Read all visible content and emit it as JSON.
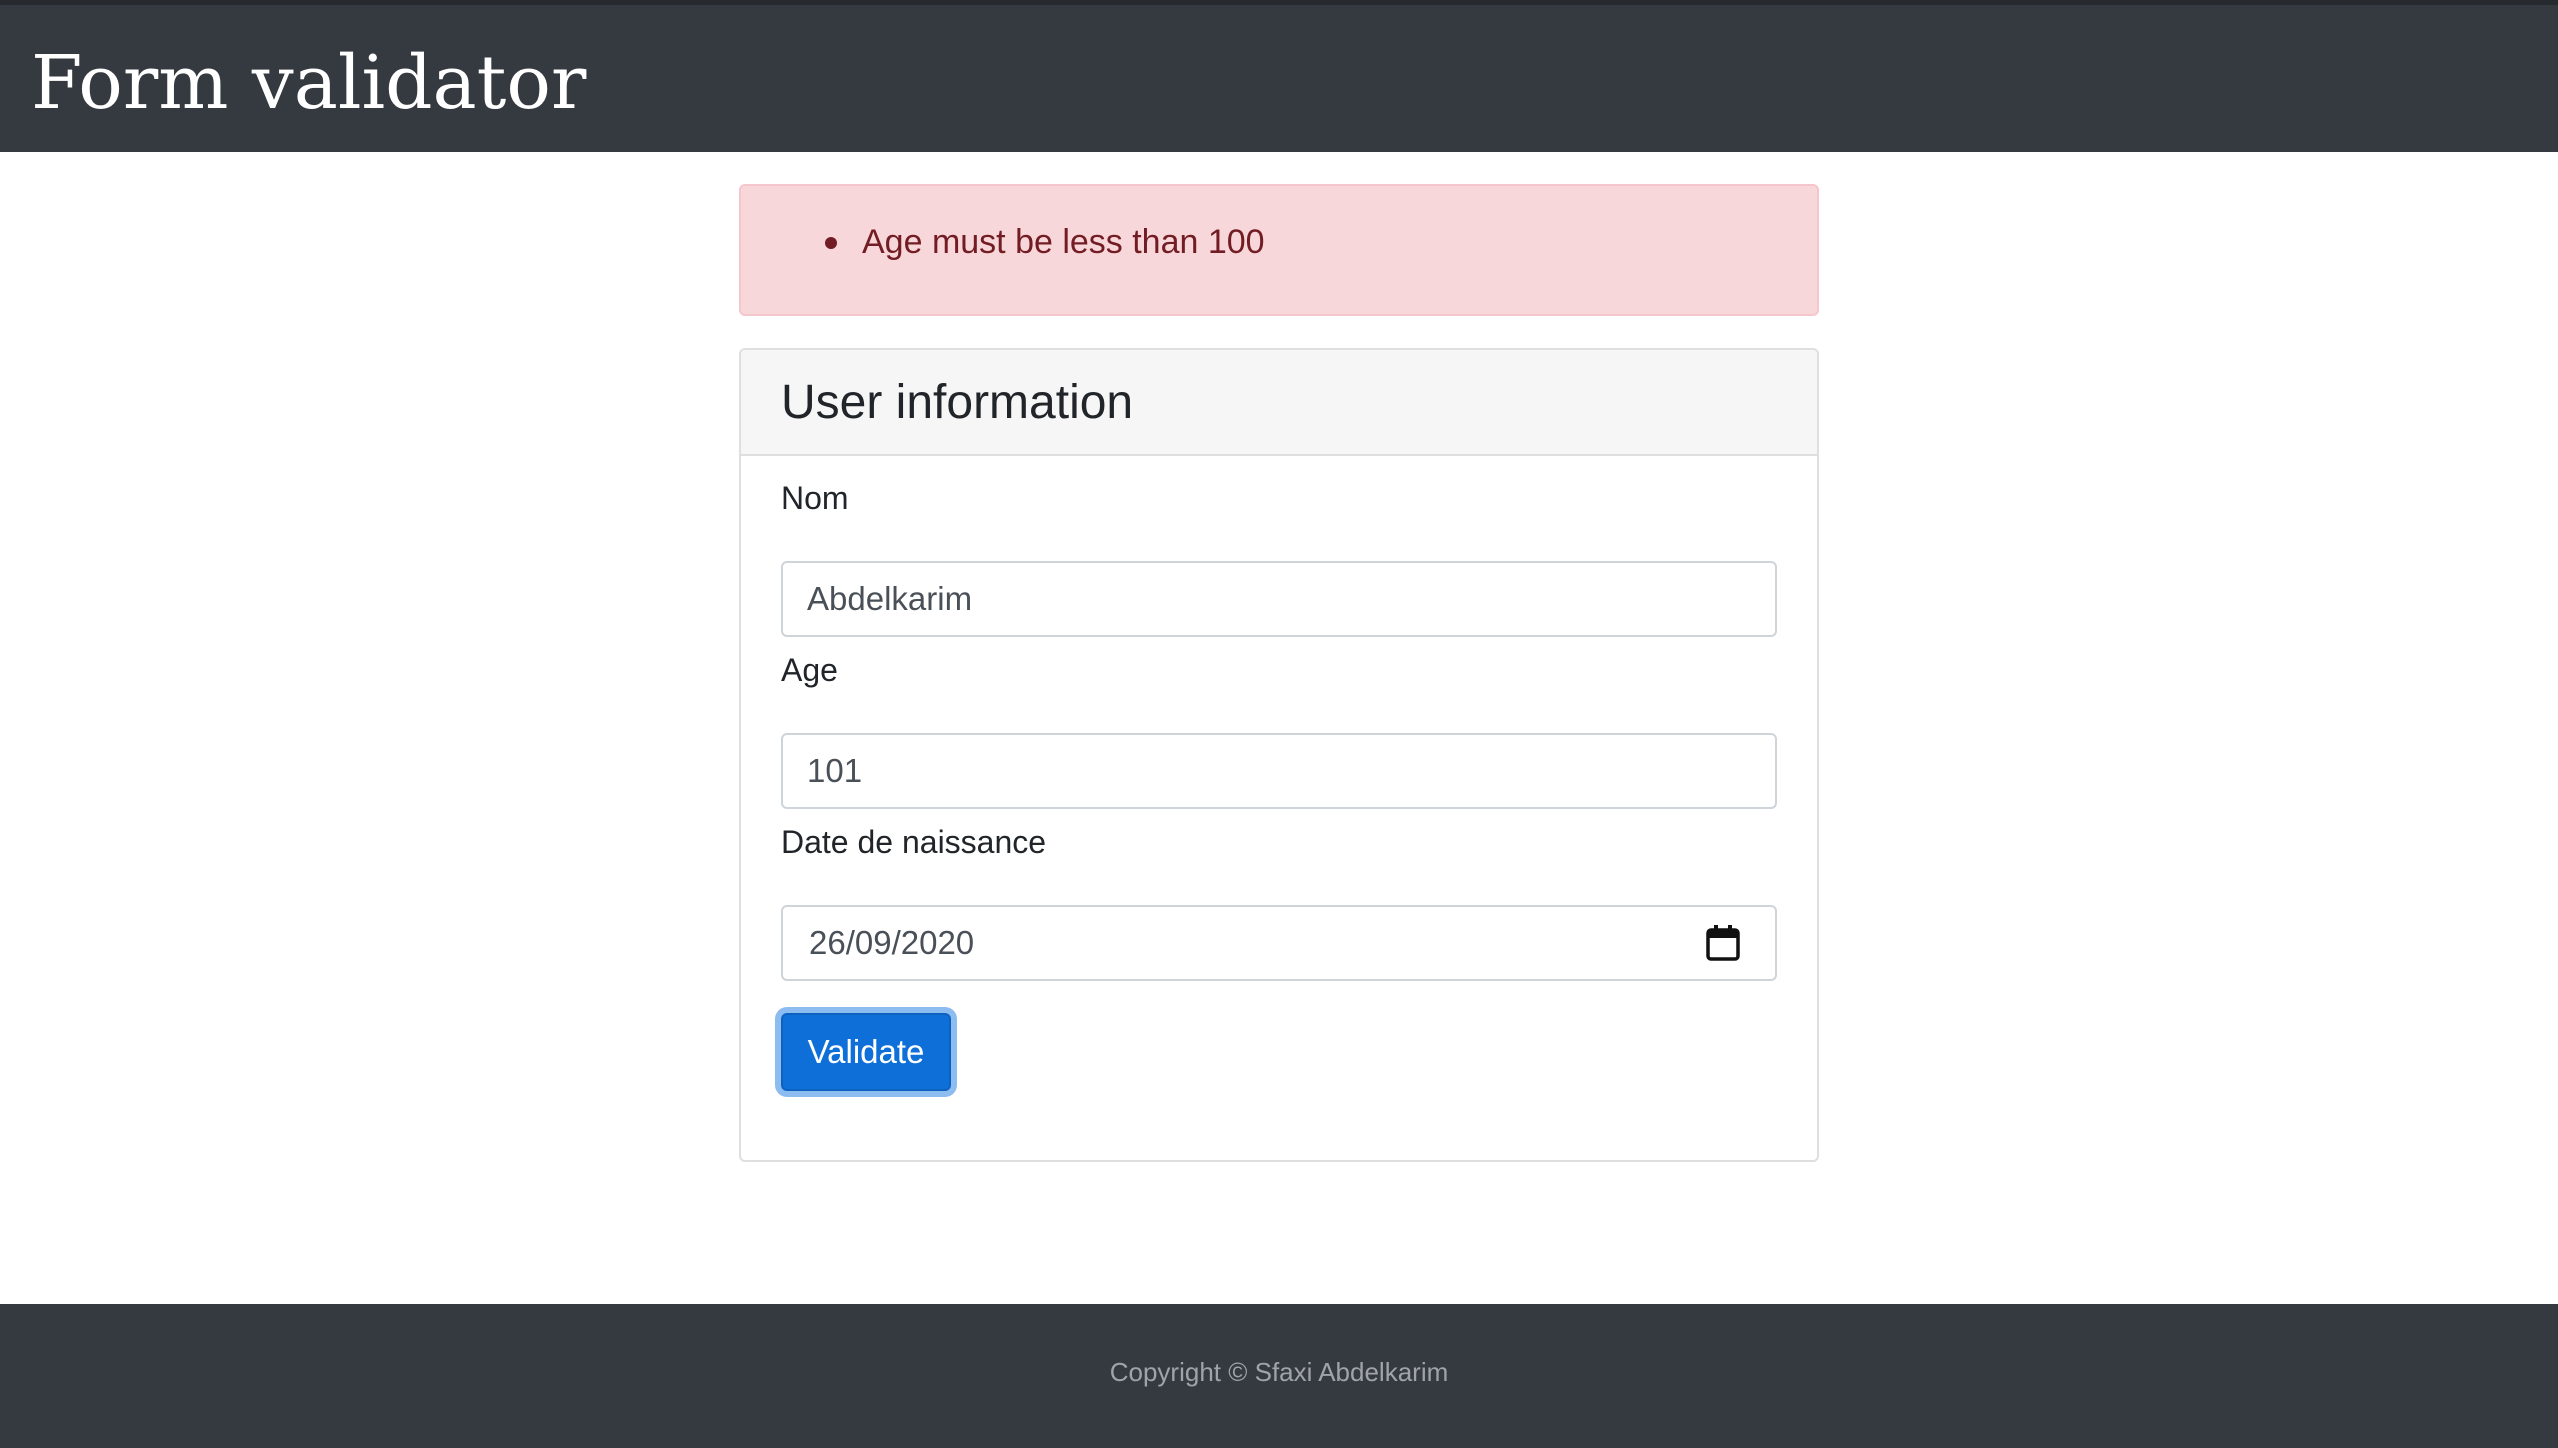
{
  "header": {
    "title": "Form validator"
  },
  "alert": {
    "errors": [
      "Age must be less than 100"
    ]
  },
  "card": {
    "title": "User information",
    "fields": {
      "nom": {
        "label": "Nom",
        "value": "Abdelkarim"
      },
      "age": {
        "label": "Age",
        "value": "101"
      },
      "birthdate": {
        "label": "Date de naissance",
        "value": "26/09/2020"
      }
    },
    "submit_label": "Validate"
  },
  "footer": {
    "copyright": "Copyright © Sfaxi Abdelkarim"
  },
  "colors": {
    "header_bg": "#343a40",
    "alert_bg": "#f8d7da",
    "alert_text": "#721c24",
    "button_bg": "#0f6fd8"
  },
  "icons": {
    "date_picker": "calendar-icon"
  }
}
